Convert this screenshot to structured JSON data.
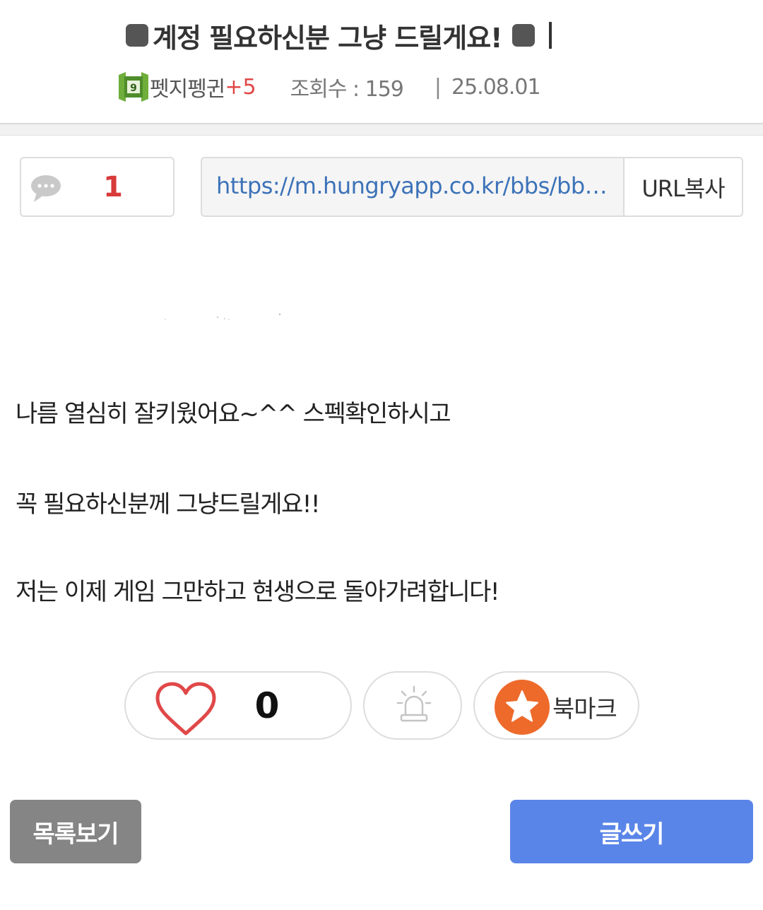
{
  "post": {
    "title": "계정 필요하신분 그냥 드릴게요!",
    "author": "펫지펭귄",
    "author_level_badge": "+5",
    "views_label": "조회수 : 159",
    "separator": "|",
    "date": "25.08.01"
  },
  "share": {
    "comment_count": "1",
    "url": "https://m.hungryapp.co.kr/bbs/bbs_...",
    "copy_label": "URL복사"
  },
  "body": {
    "lines": [
      "나름 열심히 잘키웠어요~^^ 스펙확인하시고",
      "꼭 필요하신분께 그냥드릴게요!!",
      "저는 이제 게임 그만하고 현생으로 돌아가려합니다!"
    ]
  },
  "actions": {
    "like_count": "0",
    "bookmark_label": "북마크"
  },
  "footer": {
    "list_label": "목록보기",
    "write_label": "글쓰기"
  },
  "colors": {
    "accent_red": "#e04848",
    "link_blue": "#3c72b8",
    "write_button": "#5a85e8",
    "list_button": "#858585",
    "bookmark_orange": "#ee6a2b"
  },
  "icons": [
    "level-badge-icon",
    "speech-bubble-icon",
    "heart-icon",
    "siren-icon",
    "star-icon"
  ]
}
